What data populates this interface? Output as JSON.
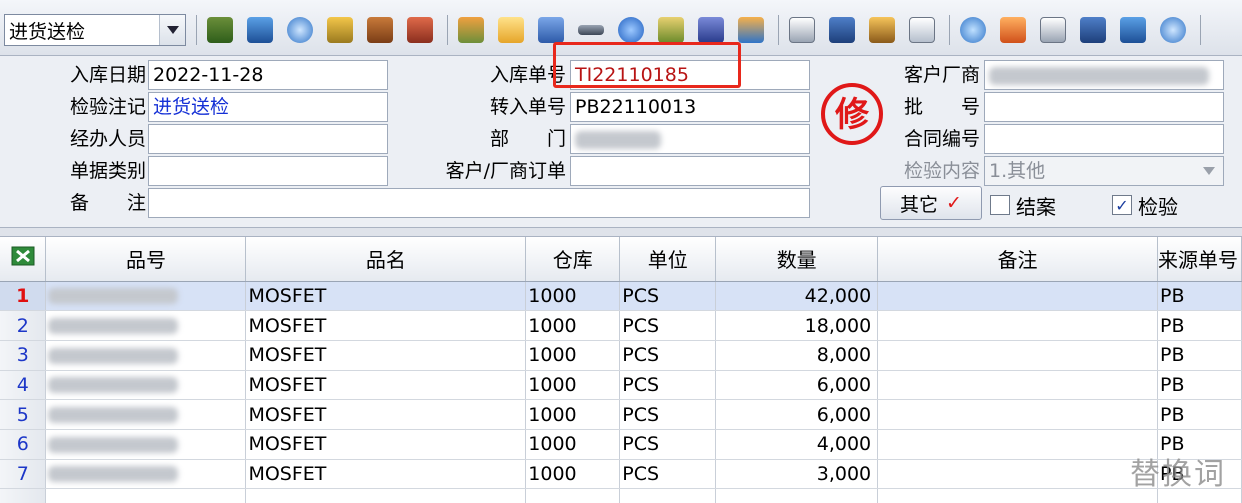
{
  "toolbar": {
    "mode_select_value": "进货送检"
  },
  "form": {
    "inbound_date_label": "入库日期",
    "inbound_date_value": "2022-11-28",
    "inspection_note_label": "检验注记",
    "inspection_note_value": "进货送检",
    "handler_label": "经办人员",
    "doc_type_label": "单据类别",
    "remark_label": "备　　注",
    "inbound_no_label": "入库单号",
    "inbound_no_value": "TI22110185",
    "transfer_no_label": "转入单号",
    "transfer_no_value": "PB22110013",
    "department_label": "部　　门",
    "customer_order_label": "客户/厂商订单",
    "vendor_label": "客户厂商",
    "batch_label": "批　　号",
    "contract_label": "合同编号",
    "inspection_content_label": "检验内容",
    "inspection_content_value": "1.其他",
    "other_button_label": "其它",
    "other_button_mark": "✓",
    "close_case_label": "结案",
    "inspect_label": "检验",
    "stamp_char": "修"
  },
  "grid": {
    "columns": [
      "品号",
      "品名",
      "仓库",
      "单位",
      "数量",
      "备注",
      "来源单号"
    ],
    "rows": [
      {
        "no": "1",
        "name": "MOSFET",
        "warehouse": "1000",
        "unit": "PCS",
        "qty": "42,000",
        "source": "PB"
      },
      {
        "no": "2",
        "name": "MOSFET",
        "warehouse": "1000",
        "unit": "PCS",
        "qty": "18,000",
        "source": "PB"
      },
      {
        "no": "3",
        "name": "MOSFET",
        "warehouse": "1000",
        "unit": "PCS",
        "qty": "8,000",
        "source": "PB"
      },
      {
        "no": "4",
        "name": "MOSFET",
        "warehouse": "1000",
        "unit": "PCS",
        "qty": "6,000",
        "source": "PB"
      },
      {
        "no": "5",
        "name": "MOSFET",
        "warehouse": "1000",
        "unit": "PCS",
        "qty": "6,000",
        "source": "PB"
      },
      {
        "no": "6",
        "name": "MOSFET",
        "warehouse": "1000",
        "unit": "PCS",
        "qty": "4,000",
        "source": "PB"
      },
      {
        "no": "7",
        "name": "MOSFET",
        "warehouse": "1000",
        "unit": "PCS",
        "qty": "3,000",
        "source": "PB"
      }
    ]
  },
  "watermark": "替换词",
  "colors": {
    "highlight_box": "#e8281c",
    "selected_row": "#d7e2f6",
    "link_blue": "#1530d6"
  }
}
